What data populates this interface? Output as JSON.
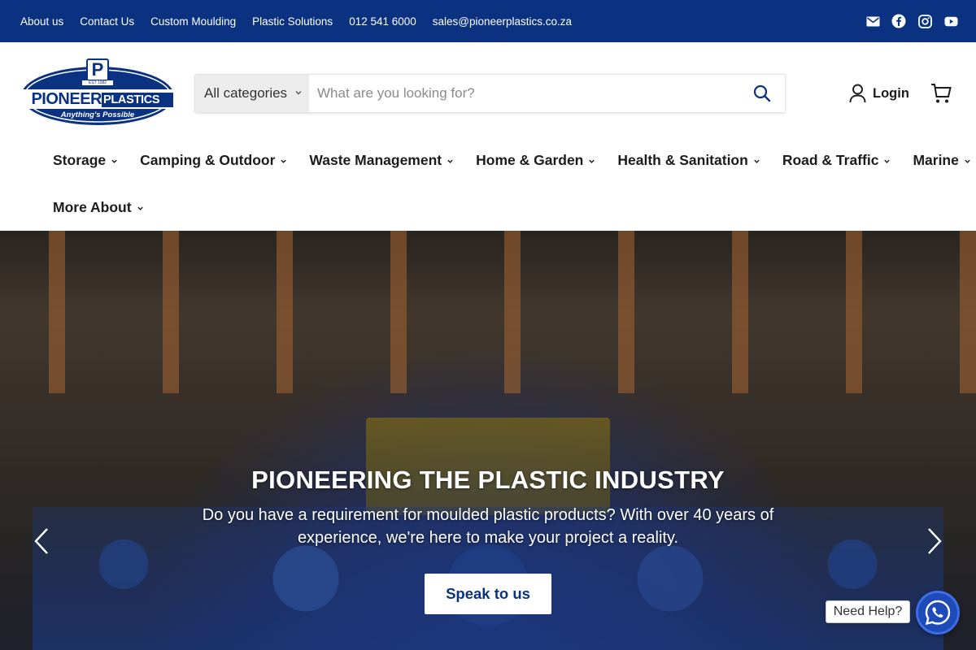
{
  "topbar": {
    "links": [
      "About us",
      "Contact Us",
      "Custom Moulding",
      "Plastic Solutions",
      "012 541 6000",
      "sales@pioneerplastics.co.za"
    ],
    "social_icons": [
      "email-icon",
      "facebook-icon",
      "instagram-icon",
      "youtube-icon"
    ]
  },
  "logo": {
    "brand_left": "PIONEER",
    "brand_right": "PLASTICS",
    "tagline": "Anything's Possible",
    "est": "EST 1982",
    "mark": "P"
  },
  "search": {
    "category_label": "All categories",
    "placeholder": "What are you looking for?"
  },
  "account": {
    "login_label": "Login"
  },
  "nav": {
    "items": [
      "Storage",
      "Camping & Outdoor",
      "Waste Management",
      "Home & Garden",
      "Health & Sanitation",
      "Road & Traffic",
      "Marine"
    ],
    "more": "More About"
  },
  "hero": {
    "title": "PIONEERING THE PLASTIC INDUSTRY",
    "subtitle": "Do you have a requirement for moulded plastic products? With over 40 years of experience, we're here to make your project a reality.",
    "cta": "Speak to us"
  },
  "help": {
    "label": "Need Help?"
  },
  "colors": {
    "brand_blue": "#0a3281",
    "white": "#ffffff",
    "text_dark": "#1c1c1c"
  }
}
